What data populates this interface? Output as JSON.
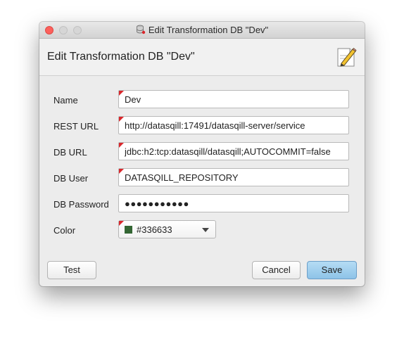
{
  "window": {
    "title": "Edit Transformation DB \"Dev\"",
    "header_title": "Edit Transformation DB \"Dev\""
  },
  "form": {
    "fields": [
      {
        "label": "Name",
        "value": "Dev"
      },
      {
        "label": "REST URL",
        "value": "http://datasqill:17491/datasqill-server/service"
      },
      {
        "label": "DB URL",
        "value": "jdbc:h2:tcp:datasqill/datasqill;AUTOCOMMIT=false"
      },
      {
        "label": "DB User",
        "value": "DATASQILL_REPOSITORY"
      },
      {
        "label": "DB Password",
        "value": "●●●●●●●●●●●"
      }
    ],
    "color": {
      "label": "Color",
      "value": "#336633",
      "swatch": "#336633"
    }
  },
  "buttons": {
    "test": "Test",
    "cancel": "Cancel",
    "save": "Save"
  },
  "icons": {
    "title": "database-icon",
    "header": "edit-pencil-icon"
  },
  "colors": {
    "required_marker": "#d9262b",
    "primary_button": "#8ec3e8",
    "close_button": "#fc605c"
  }
}
